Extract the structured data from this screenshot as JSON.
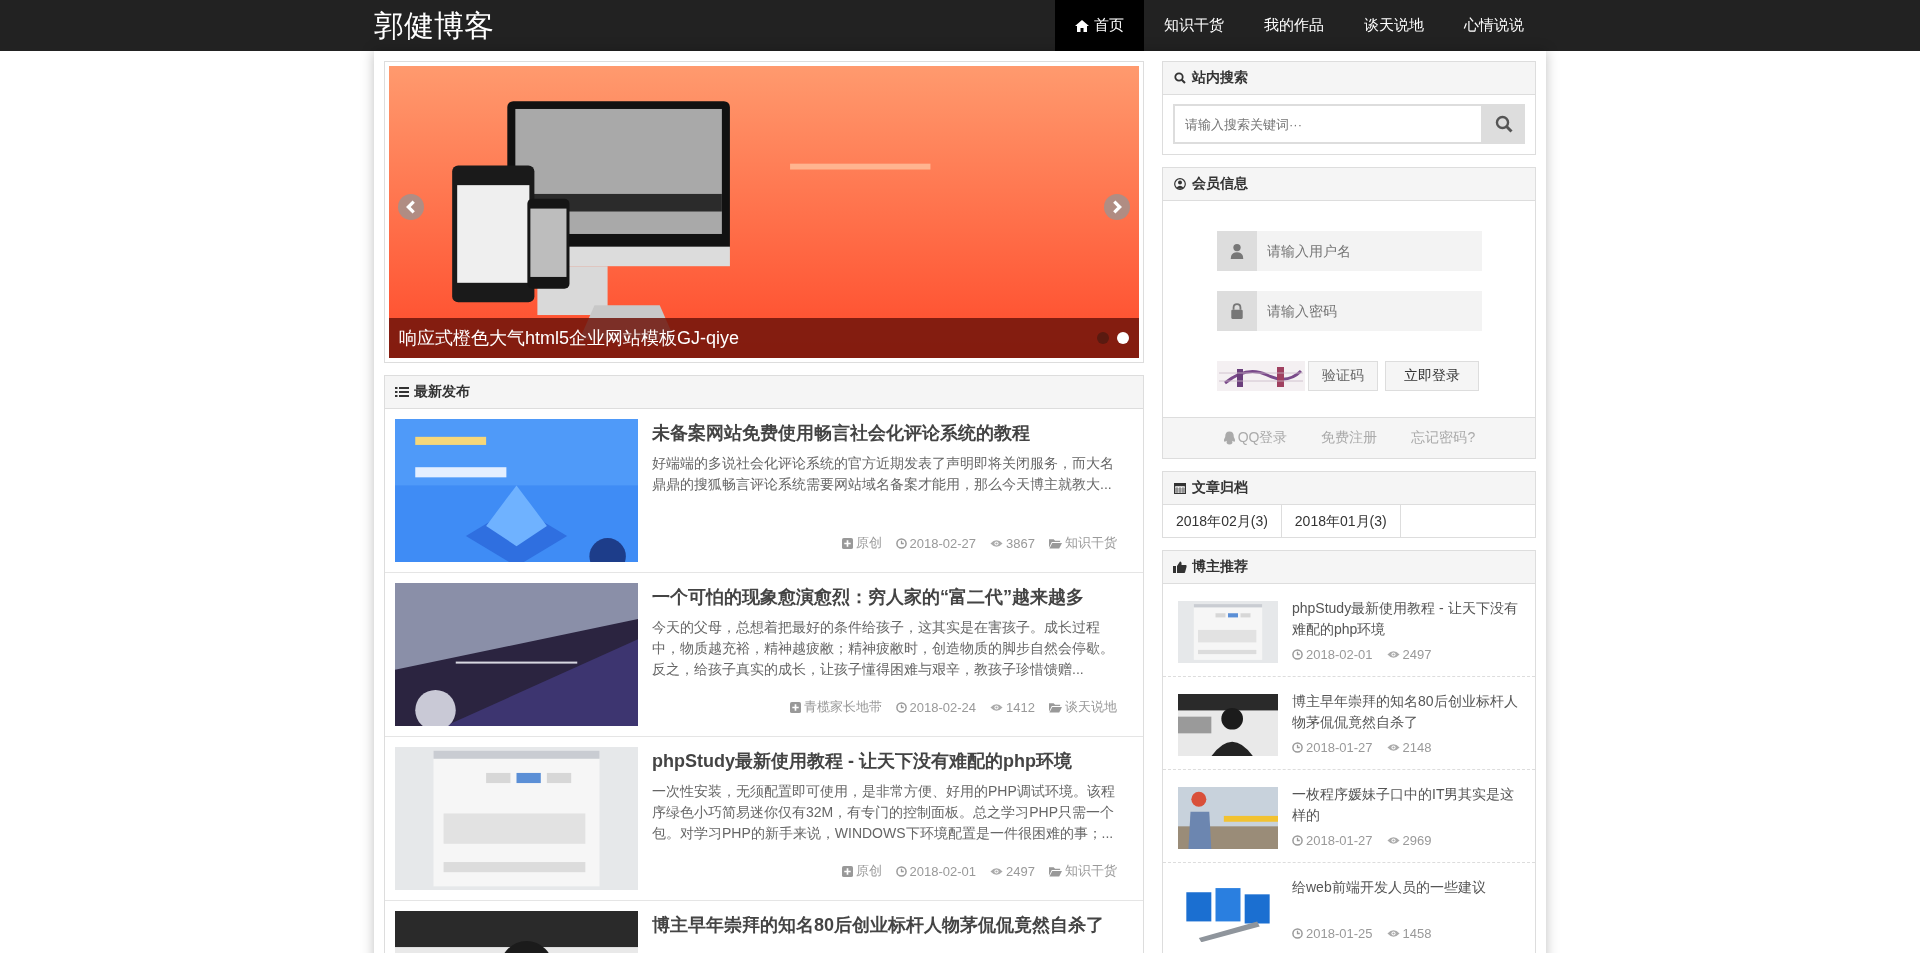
{
  "header": {
    "logo": "郭健博客",
    "nav": [
      {
        "label": "首页",
        "kind": "home",
        "selected": true
      },
      {
        "label": "知识干货",
        "kind": "plain",
        "selected": false
      },
      {
        "label": "我的作品",
        "kind": "plain",
        "selected": false
      },
      {
        "label": "谈天说地",
        "kind": "plain",
        "selected": false
      },
      {
        "label": "心情说说",
        "kind": "plain",
        "selected": false
      }
    ]
  },
  "slider": {
    "caption": "响应式橙色大气html5企业网站模板GJ-qiye",
    "dots": [
      {
        "selected": false
      },
      {
        "selected": true
      }
    ]
  },
  "latest": {
    "title": "最新发布",
    "articles": [
      {
        "title": "未备案网站免费使用畅言社会化评论系统的教程",
        "excerpt": "好端端的多说社会化评论系统的官方近期发表了声明即将关闭服务，而大名鼎鼎的搜狐畅言评论系统需要网站域名备案才能用，那么今天博主就教大...",
        "source": "原创",
        "date": "2018-02-27",
        "views": "3867",
        "category": "知识干货"
      },
      {
        "title": "一个可怕的现象愈演愈烈：穷人家的“富二代”越来越多",
        "excerpt": "今天的父母，总想着把最好的条件给孩子，这其实是在害孩子。成长过程中，物质越充裕，精神越疲敝；精神疲敝时，创造物质的脚步自然会停歇。反之，给孩子真实的成长，让孩子懂得困难与艰辛，教孩子珍惜馈赠...",
        "source": "青榄家长地带",
        "date": "2018-02-24",
        "views": "1412",
        "category": "谈天说地"
      },
      {
        "title": "phpStudy最新使用教程 - 让天下没有难配的php环境",
        "excerpt": "一次性安装，无须配置即可使用，是非常方便、好用的PHP调试环境。该程序绿色小巧简易迷你仅有32M，有专门的控制面板。总之学习PHP只需一个包。对学习PHP的新手来说，WINDOWS下环境配置是一件很困难的事；...",
        "source": "原创",
        "date": "2018-02-01",
        "views": "2497",
        "category": "知识干货"
      },
      {
        "title": "博主早年崇拜的知名80后创业标杆人物茅侃侃竟然自杀了"
      }
    ]
  },
  "sidebar": {
    "search": {
      "title": "站内搜索",
      "placeholder": "请输入搜索关键词···"
    },
    "member": {
      "title": "会员信息",
      "username_placeholder": "请输入用户名",
      "password_placeholder": "请输入密码",
      "captcha_button": "验证码",
      "login_button": "立即登录",
      "links": [
        {
          "label": "QQ登录",
          "kind": "qq"
        },
        {
          "label": "免费注册",
          "kind": "plain"
        },
        {
          "label": "忘记密码?",
          "kind": "plain"
        }
      ]
    },
    "archive": {
      "title": "文章归档",
      "months": [
        "2018年02月(3)",
        "2018年01月(3)"
      ]
    },
    "recommend": {
      "title": "博主推荐",
      "items": [
        {
          "title": "phpStudy最新使用教程 - 让天下没有难配的php环境",
          "date": "2018-02-01",
          "views": "2497"
        },
        {
          "title": "博主早年崇拜的知名80后创业标杆人物茅侃侃竟然自杀了",
          "date": "2018-01-27",
          "views": "2148"
        },
        {
          "title": "一枚程序媛妹子口中的IT男其实是这样的",
          "date": "2018-01-27",
          "views": "2969"
        },
        {
          "title": "给web前端开发人员的一些建议",
          "date": "2018-01-25",
          "views": "1458"
        }
      ]
    }
  }
}
